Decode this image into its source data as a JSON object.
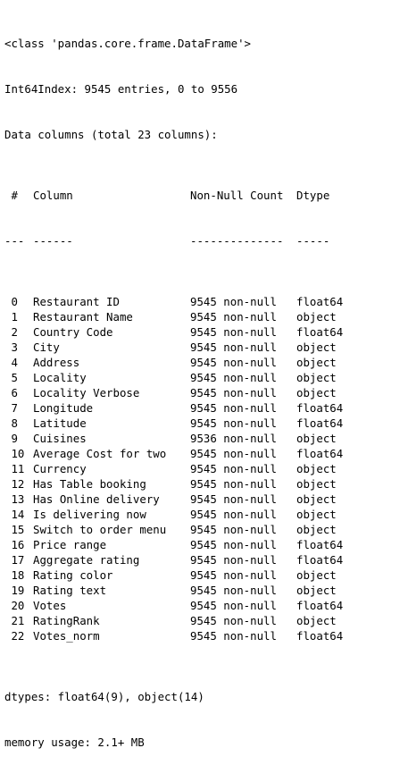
{
  "header": {
    "class_line": "<class 'pandas.core.frame.DataFrame'>",
    "index_line": "Int64Index: 9545 entries, 0 to 9556",
    "columns_line": "Data columns (total 23 columns):"
  },
  "table": {
    "headers": {
      "idx": " #",
      "column": "Column",
      "non_null": "Non-Null Count",
      "dtype": "Dtype"
    },
    "separators": {
      "idx": "---",
      "column": "------",
      "non_null": "--------------",
      "dtype": "-----"
    },
    "rows": [
      {
        "idx": " 0",
        "column": "Restaurant ID",
        "non_null": "9545 non-null",
        "dtype": "float64"
      },
      {
        "idx": " 1",
        "column": "Restaurant Name",
        "non_null": "9545 non-null",
        "dtype": "object"
      },
      {
        "idx": " 2",
        "column": "Country Code",
        "non_null": "9545 non-null",
        "dtype": "float64"
      },
      {
        "idx": " 3",
        "column": "City",
        "non_null": "9545 non-null",
        "dtype": "object"
      },
      {
        "idx": " 4",
        "column": "Address",
        "non_null": "9545 non-null",
        "dtype": "object"
      },
      {
        "idx": " 5",
        "column": "Locality",
        "non_null": "9545 non-null",
        "dtype": "object"
      },
      {
        "idx": " 6",
        "column": "Locality Verbose",
        "non_null": "9545 non-null",
        "dtype": "object"
      },
      {
        "idx": " 7",
        "column": "Longitude",
        "non_null": "9545 non-null",
        "dtype": "float64"
      },
      {
        "idx": " 8",
        "column": "Latitude",
        "non_null": "9545 non-null",
        "dtype": "float64"
      },
      {
        "idx": " 9",
        "column": "Cuisines",
        "non_null": "9536 non-null",
        "dtype": "object"
      },
      {
        "idx": " 10",
        "column": "Average Cost for two",
        "non_null": "9545 non-null",
        "dtype": "float64"
      },
      {
        "idx": " 11",
        "column": "Currency",
        "non_null": "9545 non-null",
        "dtype": "object"
      },
      {
        "idx": " 12",
        "column": "Has Table booking",
        "non_null": "9545 non-null",
        "dtype": "object"
      },
      {
        "idx": " 13",
        "column": "Has Online delivery",
        "non_null": "9545 non-null",
        "dtype": "object"
      },
      {
        "idx": " 14",
        "column": "Is delivering now",
        "non_null": "9545 non-null",
        "dtype": "object"
      },
      {
        "idx": " 15",
        "column": "Switch to order menu",
        "non_null": "9545 non-null",
        "dtype": "object"
      },
      {
        "idx": " 16",
        "column": "Price range",
        "non_null": "9545 non-null",
        "dtype": "float64"
      },
      {
        "idx": " 17",
        "column": "Aggregate rating",
        "non_null": "9545 non-null",
        "dtype": "float64"
      },
      {
        "idx": " 18",
        "column": "Rating color",
        "non_null": "9545 non-null",
        "dtype": "object"
      },
      {
        "idx": " 19",
        "column": "Rating text",
        "non_null": "9545 non-null",
        "dtype": "object"
      },
      {
        "idx": " 20",
        "column": "Votes",
        "non_null": "9545 non-null",
        "dtype": "float64"
      },
      {
        "idx": " 21",
        "column": "RatingRank",
        "non_null": "9545 non-null",
        "dtype": "object"
      },
      {
        "idx": " 22",
        "column": "Votes_norm",
        "non_null": "9545 non-null",
        "dtype": "float64"
      }
    ]
  },
  "footer": {
    "dtypes_line": "dtypes: float64(9), object(14)",
    "memory_line": "memory usage: 2.1+ MB"
  }
}
